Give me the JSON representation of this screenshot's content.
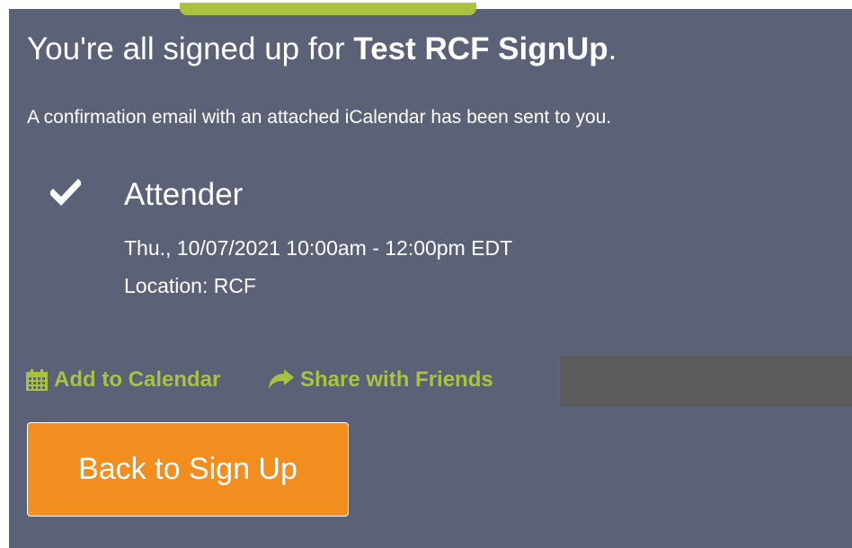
{
  "confirmation": {
    "title_prefix": "You're all signed up for ",
    "event_name": "Test RCF SignUp",
    "title_suffix": ".",
    "message": "A confirmation email with an attached iCalendar has been sent to you."
  },
  "slot": {
    "status_icon": "checkmark-icon",
    "role": "Attender",
    "datetime": "Thu., 10/07/2021 10:00am - 12:00pm EDT",
    "location": "Location: RCF"
  },
  "actions": {
    "add_to_calendar": "Add to Calendar",
    "add_to_calendar_icon": "calendar-icon",
    "share": "Share with Friends",
    "share_icon": "share-arrow-icon",
    "back_button": "Back to Sign Up"
  },
  "colors": {
    "panel_background": "#5b6177",
    "accent_green": "#a9c23f",
    "button_orange": "#f28d1f",
    "text": "#ffffff"
  }
}
